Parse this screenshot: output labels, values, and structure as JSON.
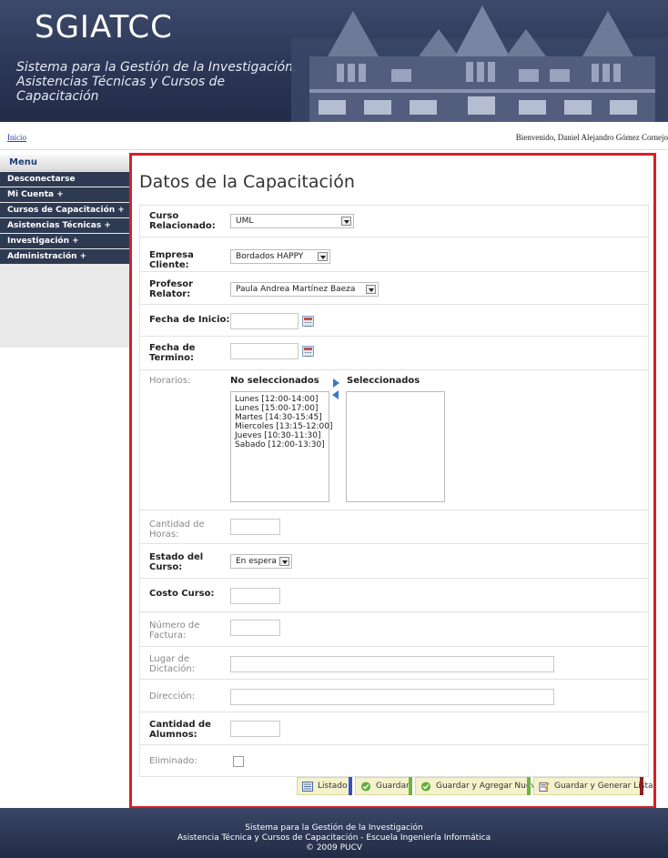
{
  "header": {
    "title": "SGIATCC",
    "subtitle_line1": "Sistema para la Gestión de la Investigación,",
    "subtitle_line2": "Asistencias Técnicas y Cursos de Capacitación"
  },
  "topbar": {
    "breadcrumb_home": "Inicio",
    "welcome": "Bienvenido, Daniel Alejandro Gómez Cornejo"
  },
  "sidebar": {
    "header": "Menu",
    "items": [
      {
        "label": "Desconectarse"
      },
      {
        "label": "Mi Cuenta +"
      },
      {
        "label": "Cursos de Capacitación +"
      },
      {
        "label": "Asistencias Técnicas +"
      },
      {
        "label": "Investigación +"
      },
      {
        "label": "Administración +"
      }
    ]
  },
  "form": {
    "title": "Datos de la Capacitación",
    "curso_relacionado": {
      "label_1": "Curso",
      "label_2": "Relacionado:",
      "value": "UML"
    },
    "empresa_cliente": {
      "label": "Empresa Cliente:",
      "value": "Bordados HAPPY"
    },
    "profesor_relator": {
      "label_1": "Profesor",
      "label_2": "Relator:",
      "value": "Paula Andrea Martínez Baeza"
    },
    "fecha_inicio": {
      "label": "Fecha de Inicio:",
      "value": ""
    },
    "fecha_termino": {
      "label_1": "Fecha de",
      "label_2": "Termino:",
      "value": ""
    },
    "horarios": {
      "label": "Horarios:",
      "available_header": "No seleccionados",
      "selected_header": "Seleccionados",
      "available": [
        "Lunes [12:00-14:00]",
        "Lunes [15:00-17:00]",
        "Martes [14:30-15:45]",
        "Miercoles [13:15-12:00]",
        "Jueves [10:30-11:30]",
        "Sabado [12:00-13:30]"
      ],
      "selected": []
    },
    "cantidad_horas": {
      "label_1": "Cantidad de",
      "label_2": "Horas:",
      "value": ""
    },
    "estado_curso": {
      "label_1": "Estado del",
      "label_2": "Curso:",
      "value": "En espera"
    },
    "costo_curso": {
      "label": "Costo Curso:",
      "value": ""
    },
    "numero_factura": {
      "label_1": "Número de",
      "label_2": "Factura:",
      "value": ""
    },
    "lugar_dictacion": {
      "label_1": "Lugar de",
      "label_2": "Dictación:",
      "value": ""
    },
    "direccion": {
      "label": "Dirección:",
      "value": ""
    },
    "cantidad_alumnos": {
      "label_1": "Cantidad de",
      "label_2": "Alumnos:",
      "value": ""
    },
    "eliminado": {
      "label": "Eliminado:",
      "checked": false
    }
  },
  "buttons": {
    "listado": "Listado",
    "guardar": "Guardar",
    "guardar_agregar": "Guardar y Agregar Nuevo",
    "guardar_lista": "Guardar y Generar Lista"
  },
  "footer": {
    "line1": "Sistema para la Gestión de la Investigación",
    "line2": "Asistencia Técnica y Cursos de Capacitación - Escuela Ingeniería Informática",
    "line3": "© 2009 PUCV"
  },
  "colors": {
    "header_bg": "#2c3656",
    "sidebar_item_bg": "#2e3a52",
    "content_border": "#d81f26",
    "button_bg": "#f4f2cc",
    "btn_bar_listado": "#3b4fc4",
    "btn_bar_guardar": "#6db33f",
    "btn_bar_agregar": "#6db33f",
    "btn_bar_lista": "#8b2020"
  }
}
